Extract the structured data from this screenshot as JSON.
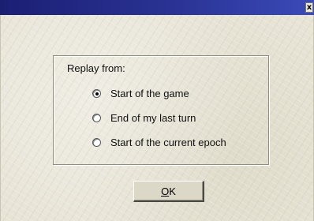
{
  "window": {
    "close_glyph": "x",
    "close_icon": "close-icon"
  },
  "dialog": {
    "group_label": "Replay from:",
    "options": [
      {
        "label": "Start of the game",
        "checked": true
      },
      {
        "label": "End of my last turn",
        "checked": false
      },
      {
        "label": "Start of the current epoch",
        "checked": false
      }
    ],
    "ok_mnemonic": "O",
    "ok_rest": "K"
  },
  "colors": {
    "titlebar": "#1b1f74",
    "background": "#e7e4d6"
  }
}
